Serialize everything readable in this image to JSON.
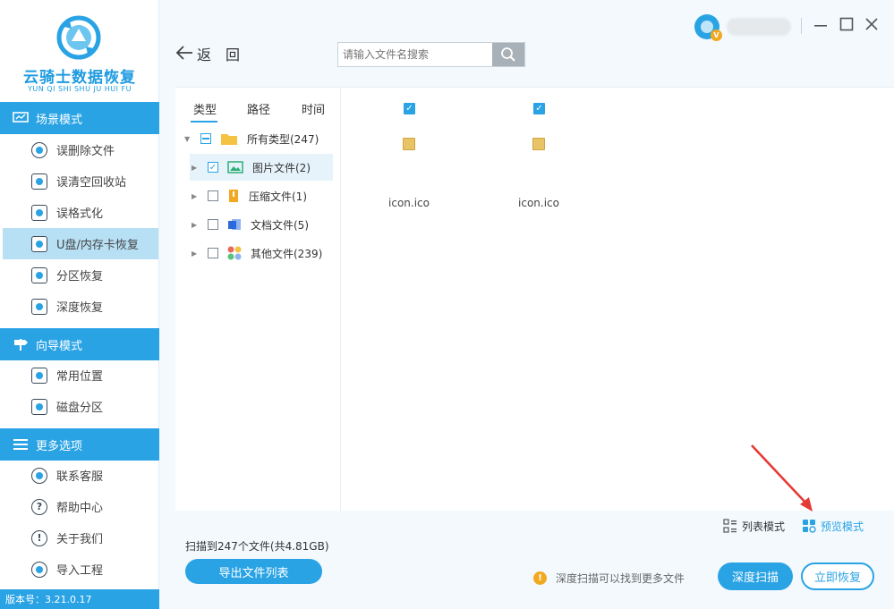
{
  "app": {
    "logo_title": "云骑士数据恢复",
    "logo_subtitle": "YUN QI SHI SHU JU HUI FU",
    "version": "版本号：3.21.0.17",
    "accent_color": "#2aa3e5"
  },
  "sidebar": {
    "sections": [
      {
        "header": "场景模式",
        "icon": "monitor-icon",
        "items": [
          {
            "label": "误删除文件",
            "icon": "deleted-file-icon",
            "active": false
          },
          {
            "label": "误清空回收站",
            "icon": "recycle-bin-icon",
            "active": false
          },
          {
            "label": "误格式化",
            "icon": "format-disk-icon",
            "active": false
          },
          {
            "label": "U盘/内存卡恢复",
            "icon": "sd-card-icon",
            "active": true
          },
          {
            "label": "分区恢复",
            "icon": "partition-icon",
            "active": false
          },
          {
            "label": "深度恢复",
            "icon": "deep-recovery-icon",
            "active": false
          }
        ]
      },
      {
        "header": "向导模式",
        "icon": "signpost-icon",
        "items": [
          {
            "label": "常用位置",
            "icon": "computer-icon",
            "active": false
          },
          {
            "label": "磁盘分区",
            "icon": "disk-partition-icon",
            "active": false
          }
        ]
      },
      {
        "header": "更多选项",
        "icon": "menu-icon",
        "items": [
          {
            "label": "联系客服",
            "icon": "phone-icon",
            "active": false
          },
          {
            "label": "帮助中心",
            "icon": "help-icon",
            "active": false
          },
          {
            "label": "关于我们",
            "icon": "info-icon",
            "active": false
          },
          {
            "label": "导入工程",
            "icon": "import-icon",
            "active": false
          }
        ]
      }
    ]
  },
  "topbar": {
    "back_label": "返　回",
    "search_placeholder": "请输入文件名搜索",
    "user_badge": "V",
    "window_controls": [
      "minimize-icon",
      "maximize-icon",
      "close-icon"
    ]
  },
  "tree": {
    "tabs": [
      "类型",
      "路径",
      "时间"
    ],
    "active_tab": 0,
    "rows": [
      {
        "label": "所有类型(247)",
        "check": "partial",
        "icon": "folder-icon",
        "color": "#f5c342"
      },
      {
        "label": "图片文件(2)",
        "check": "checked",
        "icon": "image-icon",
        "color": "#2fae77",
        "selected": true
      },
      {
        "label": "压缩文件(1)",
        "check": "unchecked",
        "icon": "zip-icon",
        "color": "#f2a922"
      },
      {
        "label": "文档文件(5)",
        "check": "unchecked",
        "icon": "document-icon",
        "color": "#2b6ad8"
      },
      {
        "label": "其他文件(239)",
        "check": "unchecked",
        "icon": "other-files-icon",
        "color": "#e96b5a"
      }
    ]
  },
  "files": [
    {
      "name": "icon.ico",
      "checked": true
    },
    {
      "name": "icon.ico",
      "checked": true
    }
  ],
  "view_modes": {
    "list": "列表模式",
    "preview": "预览模式",
    "active": "preview"
  },
  "footer": {
    "scan_status": "扫描到247个文件(共4.81GB)",
    "export_label": "导出文件列表",
    "tip": "深度扫描可以找到更多文件",
    "deep_scan_label": "深度扫描",
    "recover_label": "立即恢复"
  }
}
